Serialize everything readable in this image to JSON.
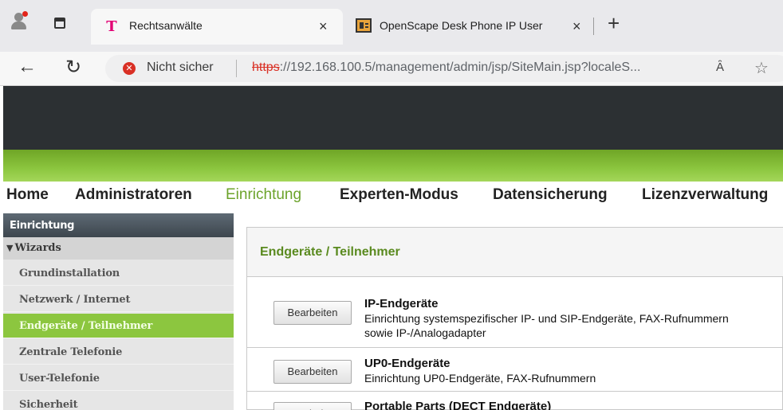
{
  "browser": {
    "tabs": [
      {
        "title": "Rechtsanwälte",
        "close": "×",
        "favicon": "telekom-t-icon"
      },
      {
        "title": "OpenScape Desk Phone IP User",
        "close": "×",
        "favicon": "openscape-icon"
      }
    ],
    "new_tab": "+",
    "address": {
      "security_label": "Nicht sicher",
      "url_protocol": "https",
      "url_rest": "://192.168.100.5/management/admin/jsp/SiteMain.jsp?localeS...",
      "read_aloud": "Ȃ"
    }
  },
  "nav": {
    "items": [
      "Home",
      "Administratoren",
      "Einrichtung",
      "Experten-Modus",
      "Datensicherung",
      "Lizenzverwaltung"
    ],
    "active": "Einrichtung"
  },
  "sidebar": {
    "header": "Einrichtung",
    "group": "Wizards",
    "items": [
      "Grundinstallation",
      "Netzwerk / Internet",
      "Endgeräte / Teilnehmer",
      "Zentrale Telefonie",
      "User-Telefonie",
      "Sicherheit"
    ],
    "active": "Endgeräte / Teilnehmer"
  },
  "content": {
    "title": "Endgeräte / Teilnehmer",
    "rows": [
      {
        "button": "Bearbeiten",
        "title": "IP-Endgeräte",
        "desc": "Einrichtung systemspezifischer IP- und SIP-Endgeräte, FAX-Rufnummern",
        "desc2": "sowie IP-/Analogadapter"
      },
      {
        "button": "Bearbeiten",
        "title": "UP0-Endgeräte",
        "desc": "Einrichtung UP0-Endgeräte, FAX-Rufnummern"
      },
      {
        "button": "Bearbeiten",
        "title": "Portable Parts (DECT Endgeräte)"
      }
    ]
  },
  "colors": {
    "accent_green": "#8cc63f",
    "header_dark": "#2c3033",
    "insecure_red": "#d93025"
  }
}
